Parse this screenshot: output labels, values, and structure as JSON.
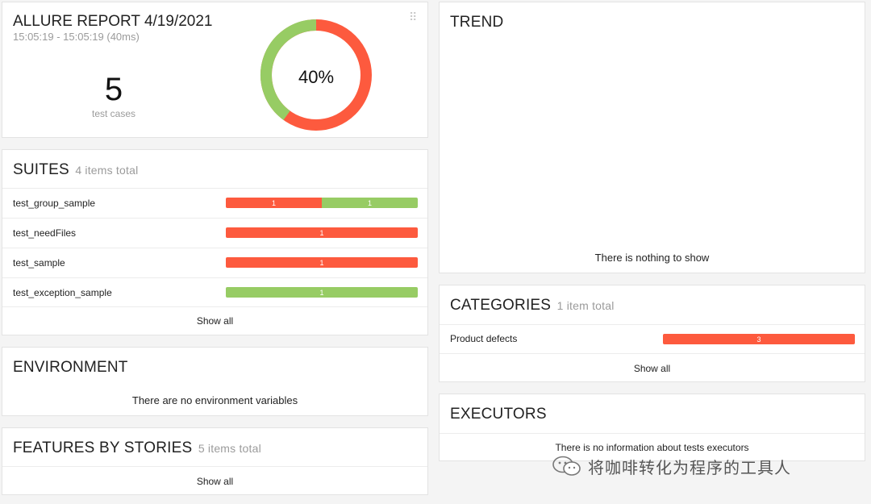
{
  "summary": {
    "title": "ALLURE REPORT 4/19/2021",
    "time": "15:05:19 - 15:05:19 (40ms)",
    "count": "5",
    "count_label": "test cases",
    "percent_label": "40%",
    "passed_fraction": 0.4,
    "colors": {
      "passed": "#97cc64",
      "failed": "#fd5a3e"
    }
  },
  "suites": {
    "title": "SUITES",
    "total": "4 items total",
    "items": [
      {
        "name": "test_group_sample",
        "failed": "1",
        "passed": "1"
      },
      {
        "name": "test_needFiles",
        "failed": "1"
      },
      {
        "name": "test_sample",
        "failed": "1"
      },
      {
        "name": "test_exception_sample",
        "passed": "1"
      }
    ],
    "show_all": "Show all"
  },
  "environment": {
    "title": "ENVIRONMENT",
    "empty": "There are no environment variables"
  },
  "features": {
    "title": "FEATURES BY STORIES",
    "total": "5 items total",
    "show_all": "Show all"
  },
  "trend": {
    "title": "TREND",
    "empty": "There is nothing to show"
  },
  "categories": {
    "title": "CATEGORIES",
    "total": "1 item total",
    "items": [
      {
        "name": "Product defects",
        "count": "3"
      }
    ],
    "show_all": "Show all"
  },
  "executors": {
    "title": "EXECUTORS",
    "empty": "There is no information about tests executors"
  },
  "watermark": {
    "text": "将咖啡转化为程序的工具人",
    "icon": "wechat-icon"
  }
}
